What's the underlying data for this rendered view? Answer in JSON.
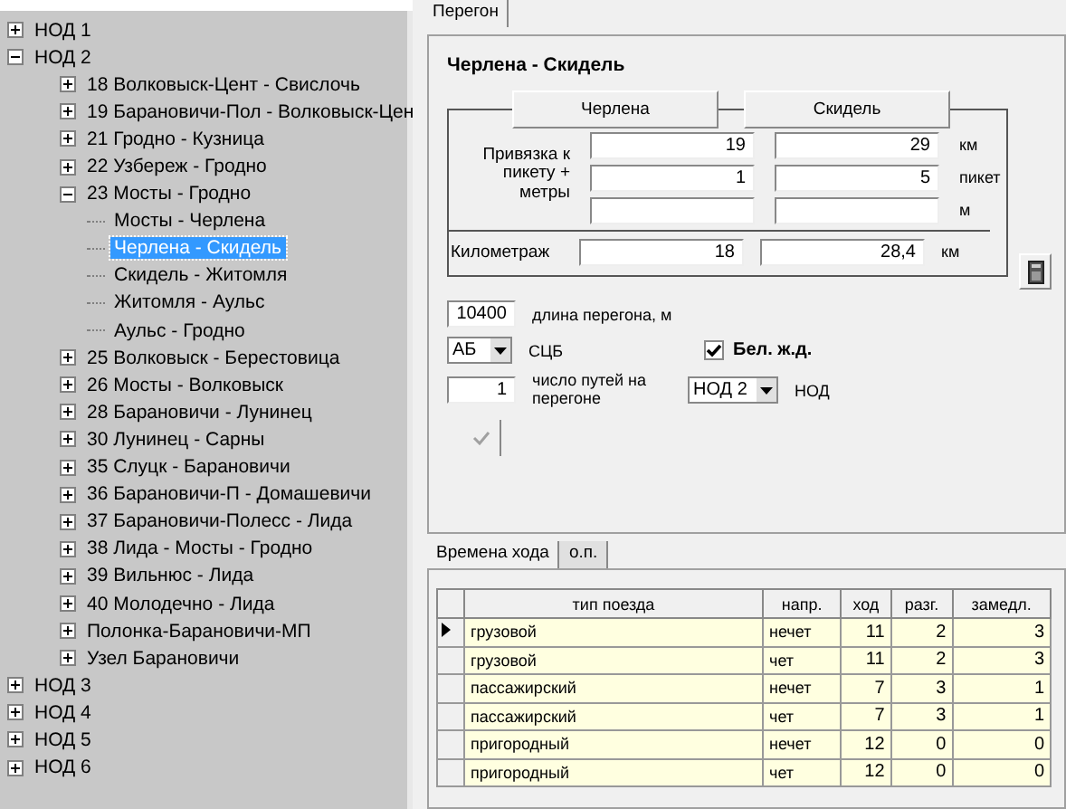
{
  "tree": [
    {
      "label": "НОД 1",
      "expanded": false,
      "selected": false
    },
    {
      "label": "НОД 2",
      "expanded": true,
      "selected": false,
      "children": [
        {
          "label": "18 Волковыск-Цент - Свислочь",
          "expanded": false,
          "selected": false
        },
        {
          "label": "19 Барановичи-Пол - Волковыск-Цен",
          "expanded": false,
          "selected": false
        },
        {
          "label": "21 Гродно - Кузница",
          "expanded": false,
          "selected": false
        },
        {
          "label": "22 Узбереж - Гродно",
          "expanded": false,
          "selected": false
        },
        {
          "label": "23 Мосты - Гродно",
          "expanded": true,
          "selected": false,
          "children": [
            {
              "label": "Мосты - Черлена",
              "selected": false
            },
            {
              "label": "Черлена - Скидель",
              "selected": true
            },
            {
              "label": "Скидель - Житомля",
              "selected": false
            },
            {
              "label": "Житомля - Аульс",
              "selected": false
            },
            {
              "label": "Аульс - Гродно",
              "selected": false
            }
          ]
        },
        {
          "label": "25 Волковыск - Берестовица",
          "expanded": false,
          "selected": false
        },
        {
          "label": "26 Мосты - Волковыск",
          "expanded": false,
          "selected": false
        },
        {
          "label": "28 Барановичи - Лунинец",
          "expanded": false,
          "selected": false
        },
        {
          "label": "30 Лунинец - Сарны",
          "expanded": false,
          "selected": false
        },
        {
          "label": "35 Слуцк - Барановичи",
          "expanded": false,
          "selected": false
        },
        {
          "label": "36 Барановичи-П - Домашевичи",
          "expanded": false,
          "selected": false
        },
        {
          "label": "37 Барановичи-Полесс - Лида",
          "expanded": false,
          "selected": false
        },
        {
          "label": "38 Лида - Мосты - Гродно",
          "expanded": false,
          "selected": false
        },
        {
          "label": "39 Вильнюс - Лида",
          "expanded": false,
          "selected": false
        },
        {
          "label": "40 Молодечно - Лида",
          "expanded": false,
          "selected": false
        },
        {
          "label": "Полонка-Барановичи-МП",
          "expanded": false,
          "selected": false
        },
        {
          "label": "Узел Барановичи",
          "expanded": false,
          "selected": false
        }
      ]
    },
    {
      "label": "НОД 3",
      "expanded": false,
      "selected": false
    },
    {
      "label": "НОД 4",
      "expanded": false,
      "selected": false
    },
    {
      "label": "НОД 5",
      "expanded": false,
      "selected": false
    },
    {
      "label": "НОД 6",
      "expanded": false,
      "selected": false
    }
  ],
  "tabs": [
    {
      "label": "Перегон",
      "selected": true
    }
  ],
  "section": {
    "title": "Черлена - Скидель",
    "stations": [
      "Черлена",
      "Скидель"
    ],
    "binding_label": "Привязка к пикету + метры",
    "binding_rows": [
      {
        "from": "19",
        "to": "29",
        "unit": "км"
      },
      {
        "from": "1",
        "to": "5",
        "unit": "пикет"
      },
      {
        "unit": "м"
      }
    ],
    "km_row": {
      "label": "Километраж",
      "from": "18",
      "to": "28,4",
      "unit": "км"
    },
    "length": {
      "value": "10400",
      "label": "длина перегона, м"
    },
    "scb": {
      "value": "АБ",
      "label": "СЦБ"
    },
    "bel_zd": {
      "label": "Бел. ж.д.",
      "checked": true
    },
    "tracks": {
      "value": "1",
      "label": "число путей на перегоне"
    },
    "nod": {
      "value": "НОД 2",
      "label": "НОД"
    }
  },
  "subtabs": [
    {
      "label": "Времена хода",
      "selected": true
    },
    {
      "label": "о.п.",
      "selected": false
    }
  ],
  "table": {
    "columns": [
      "тип поезда",
      "напр.",
      "ход",
      "разг.",
      "замедл."
    ],
    "rows": [
      {
        "cells": [
          "грузовой",
          "нечет",
          "11",
          "2",
          "3"
        ],
        "current": true
      },
      {
        "cells": [
          "грузовой",
          "чет",
          "11",
          "2",
          "3"
        ],
        "current": false
      },
      {
        "cells": [
          "пассажирский",
          "нечет",
          "7",
          "3",
          "1"
        ],
        "current": false
      },
      {
        "cells": [
          "пассажирский",
          "чет",
          "7",
          "3",
          "1"
        ],
        "current": false
      },
      {
        "cells": [
          "пригородный",
          "нечет",
          "12",
          "0",
          "0"
        ],
        "current": false
      },
      {
        "cells": [
          "пригородный",
          "чет",
          "12",
          "0",
          "0"
        ],
        "current": false
      }
    ]
  }
}
